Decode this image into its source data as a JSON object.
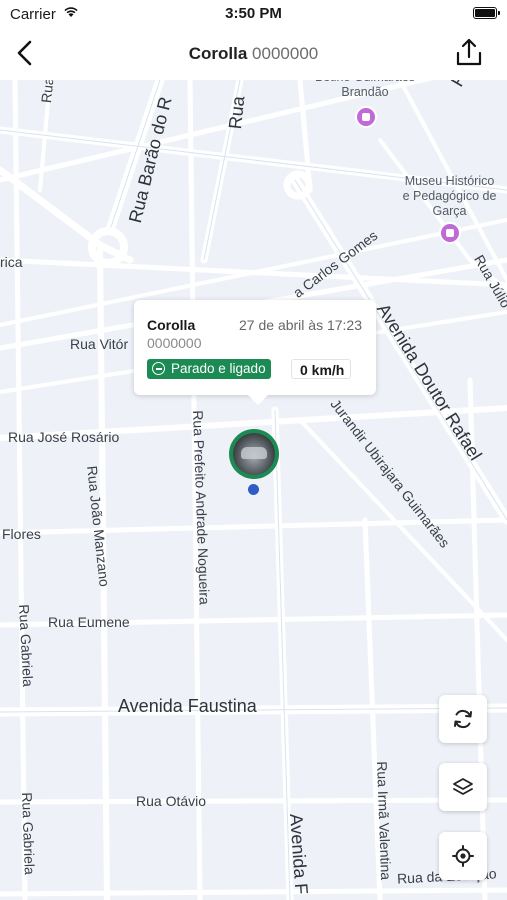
{
  "status_bar": {
    "carrier": "Carrier",
    "time": "3:50 PM"
  },
  "nav": {
    "vehicle_name": "Corolla",
    "vehicle_plate": "0000000"
  },
  "map": {
    "streets": {
      "rua_sar": "Rua Sar",
      "rua_barao_do_r": "Rua Barão do R",
      "rua": "Rua",
      "rica": "rica",
      "rua_vitor": "Rua Vitór",
      "rua_jose_rosario": "Rua José Rosário",
      "flores": "Flores",
      "rua_joao_manzano": "Rua João Manzano",
      "rua_prefeito": "Rua Prefeito Andrade Nogueira",
      "rua_eumene": "Rua Eumene",
      "rua_gabriela_1": "Rua Gabriela",
      "avenida_faustina": "Avenida Faustina",
      "rua_otavio": "Rua Otávio",
      "rua_gabriela_2": "Rua Gabriela",
      "avenida_f": "Avenida F",
      "rua_irma_valentina": "Rua Irmã Valentina",
      "rua_da_estacao": "Rua da Estação",
      "carlos_gomes": "a Carlos Gomes",
      "jurandir": "Jurandir Ubirajara Guimarães",
      "avenida_doutor": "Avenida Doutor Rafael",
      "rua_julio": "Rua Júlio",
      "r_top": "R"
    },
    "pois": {
      "betino": "Betino Guimarães\nBrandão",
      "museu": "Museu Histórico\ne Pedagógico de\nGarça"
    }
  },
  "popup": {
    "name": "Corolla",
    "timestamp": "27 de abril às 17:23",
    "plate": "0000000",
    "status": "Parado e ligado",
    "speed": "0 km/h",
    "status_color": "#1c8a53"
  },
  "controls": {
    "refresh": "refresh-icon",
    "layers": "layers-icon",
    "locate": "locate-icon"
  }
}
